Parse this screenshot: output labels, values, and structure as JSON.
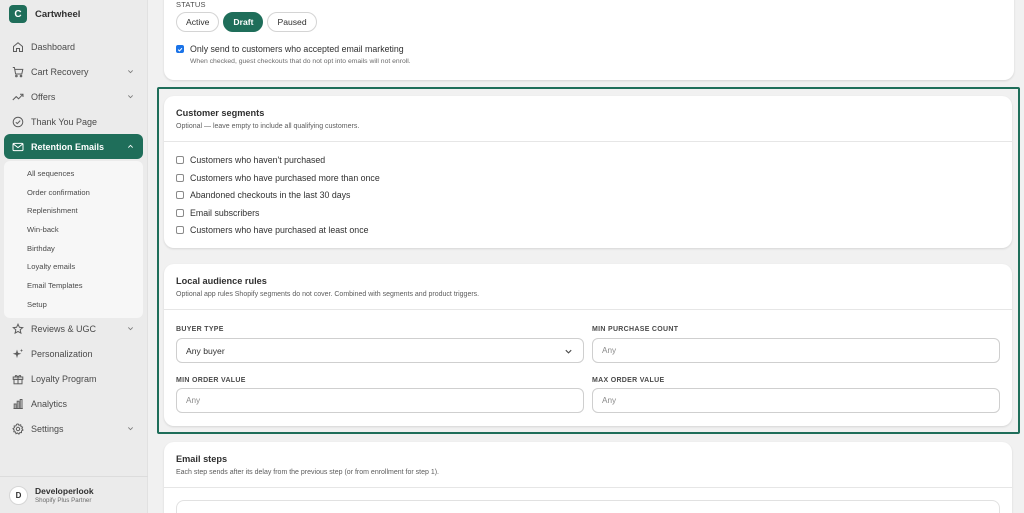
{
  "brand": {
    "initial": "C",
    "name": "Cartwheel"
  },
  "nav_top": [
    {
      "label": "Dashboard",
      "icon": "home-icon",
      "chevron": false
    },
    {
      "label": "Cart Recovery",
      "icon": "cart-icon",
      "chevron": true
    },
    {
      "label": "Offers",
      "icon": "trend-icon",
      "chevron": true
    },
    {
      "label": "Thank You Page",
      "icon": "check-circle-icon",
      "chevron": false
    },
    {
      "label": "Retention Emails",
      "icon": "mail-icon",
      "chevron": true,
      "active": true
    }
  ],
  "subnav": [
    "All sequences",
    "Order confirmation",
    "Replenishment",
    "Win-back",
    "Birthday",
    "Loyalty emails",
    "Email Templates",
    "Setup"
  ],
  "nav_bottom": [
    {
      "label": "Reviews & UGC",
      "icon": "star-icon",
      "chevron": true
    },
    {
      "label": "Personalization",
      "icon": "sparkle-icon",
      "chevron": false
    },
    {
      "label": "Loyalty Program",
      "icon": "gift-icon",
      "chevron": false
    },
    {
      "label": "Analytics",
      "icon": "bar-chart-icon",
      "chevron": false
    },
    {
      "label": "Settings",
      "icon": "gear-icon",
      "chevron": true
    }
  ],
  "user": {
    "initial": "D",
    "name": "Developerlook",
    "role": "Shopify Plus Partner"
  },
  "status": {
    "label": "STATUS",
    "options": [
      "Active",
      "Draft",
      "Paused"
    ],
    "selected": "Draft",
    "consent_label": "Only send to customers who accepted email marketing",
    "consent_checked": true,
    "consent_help": "When checked, guest checkouts that do not opt into emails will not enroll."
  },
  "segments": {
    "title": "Customer segments",
    "subtitle": "Optional — leave empty to include all qualifying customers.",
    "items": [
      "Customers who haven't purchased",
      "Customers who have purchased more than once",
      "Abandoned checkouts in the last 30 days",
      "Email subscribers",
      "Customers who have purchased at least once"
    ]
  },
  "rules": {
    "title": "Local audience rules",
    "subtitle": "Optional app rules Shopify segments do not cover. Combined with segments and product triggers.",
    "buyer_type_label": "BUYER TYPE",
    "buyer_type_value": "Any buyer",
    "min_purchase_label": "MIN PURCHASE COUNT",
    "min_purchase_placeholder": "Any",
    "min_order_label": "MIN ORDER VALUE",
    "min_order_placeholder": "Any",
    "max_order_label": "MAX ORDER VALUE",
    "max_order_placeholder": "Any"
  },
  "steps": {
    "title": "Email steps",
    "subtitle": "Each step sends after its delay from the previous step (or from enrollment for step 1)."
  },
  "colors": {
    "brand": "#1f6e5a",
    "checkbox": "#1a73e8"
  }
}
